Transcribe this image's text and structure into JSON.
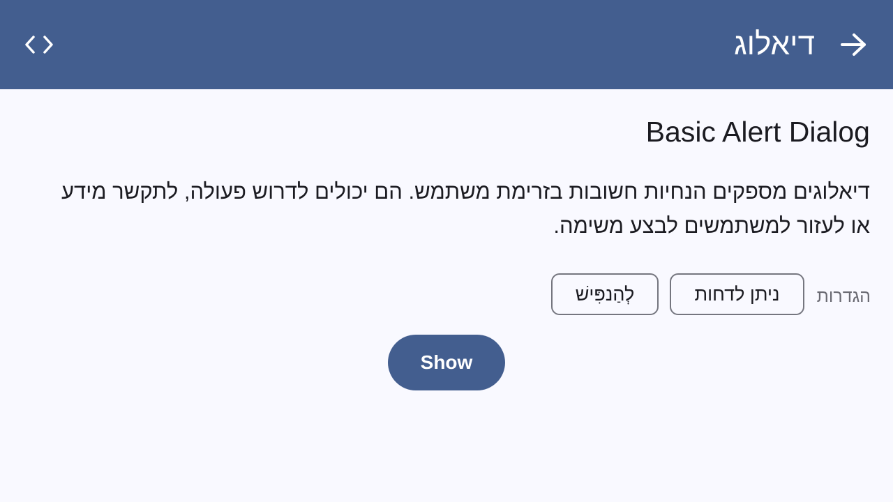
{
  "topbar": {
    "title": "דיאלוג",
    "back_icon": "arrow-forward-icon",
    "code_icon": "code-icon",
    "background_color": "#435e8f"
  },
  "content": {
    "section_title": "Basic Alert Dialog",
    "description": "דיאלוגים מספקים הנחיות חשובות בזרימת משתמש. הם יכולים לדרוש פעולה, לתקשר מידע או לעזור למשתמשים לבצע משימה.",
    "settings_label": "הגדרות",
    "chips": {
      "dismissible": "ניתן לדחות",
      "modal": "לְהַנפִּישׁ"
    },
    "show_button": "Show"
  }
}
